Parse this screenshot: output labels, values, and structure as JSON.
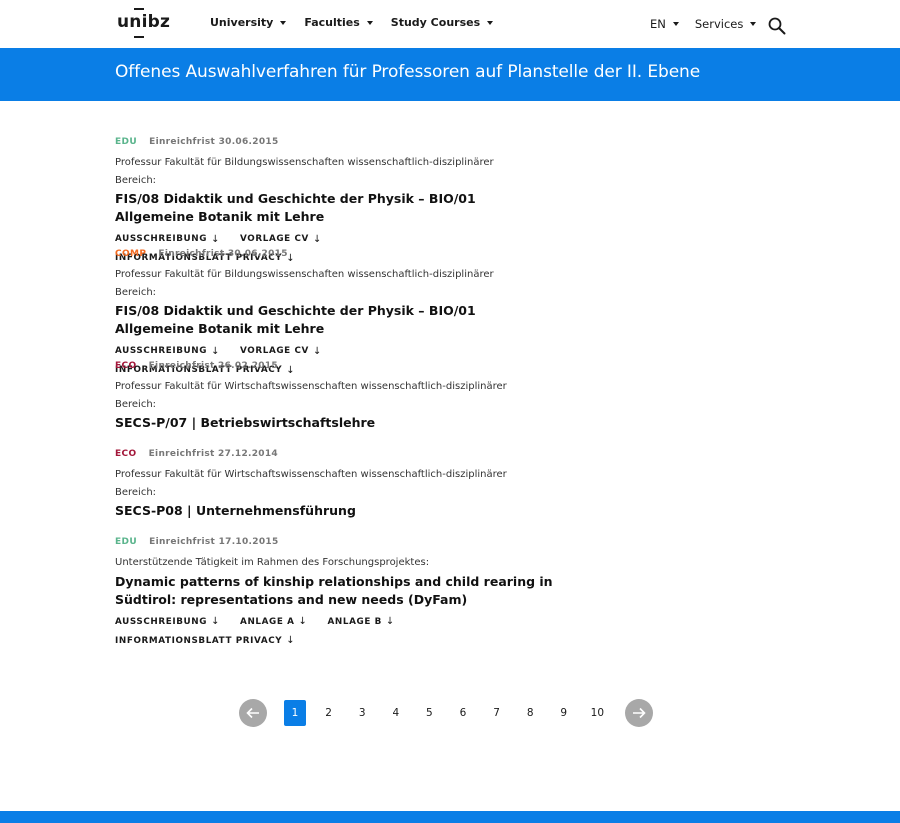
{
  "header": {
    "logo": "unibz",
    "nav": [
      "University",
      "Faculties",
      "Study Courses"
    ],
    "language": "EN",
    "services": "Services"
  },
  "banner": {
    "title": "Offenes Auswahlverfahren für Professoren auf Planstelle der II. Ebene"
  },
  "colors": {
    "accent": "#0a7ee6",
    "EDU": "#5ab48c",
    "COMP": "#f26a21",
    "ECO": "#a3173a"
  },
  "entries": [
    {
      "tag": "EDU",
      "deadline": "Einreichfrist 30.06.2015",
      "description": "Professur Fakultät für Bildungswissenschaften wissenschaftlich-disziplinärer Bereich:",
      "title": "FIS/08 Didaktik und Geschichte der Physik – BIO/01 Allgemeine Botanik mit Lehre",
      "links": [
        "AUSSCHREIBUNG",
        "VORLAGE CV",
        "INFORMATIONSBLATT PRIVACY"
      ]
    },
    {
      "tag": "COMP",
      "deadline": "Einreichfrist 30.06.2015",
      "description": "Professur Fakultät für Bildungswissenschaften wissenschaftlich-disziplinärer Bereich:",
      "title": "FIS/08 Didaktik und Geschichte der Physik – BIO/01 Allgemeine Botanik mit Lehre",
      "links": [
        "AUSSCHREIBUNG",
        "VORLAGE CV",
        "INFORMATIONSBLATT PRIVACY"
      ]
    },
    {
      "tag": "ECO",
      "deadline": "Einreichfrist 26.02.2015",
      "description": "Professur Fakultät für Wirtschaftswissenschaften wissenschaftlich-disziplinärer Bereich:",
      "title": "SECS-P/07 | Betriebswirtschaftslehre",
      "links": []
    },
    {
      "tag": "ECO",
      "deadline": "Einreichfrist 27.12.2014",
      "description": "Professur Fakultät für Wirtschaftswissenschaften wissenschaftlich-disziplinärer Bereich:",
      "title": "SECS-P08 | Unternehmensführung",
      "links": []
    },
    {
      "tag": "EDU",
      "deadline": "Einreichfrist 17.10.2015",
      "description": "Unterstützende Tätigkeit im Rahmen des Forschungsprojektes:",
      "title": "Dynamic patterns of kinship relationships and child rearing in Südtirol: representations and new needs (DyFam)",
      "links": [
        "AUSSCHREIBUNG",
        "ANLAGE A",
        "ANLAGE B",
        "INFORMATIONSBLATT PRIVACY"
      ]
    }
  ],
  "pagination": {
    "pages": [
      "1",
      "2",
      "3",
      "4",
      "5",
      "6",
      "7",
      "8",
      "9",
      "10"
    ],
    "current": "1",
    "prev_icon": "arrow-left-icon",
    "next_icon": "arrow-right-icon"
  }
}
